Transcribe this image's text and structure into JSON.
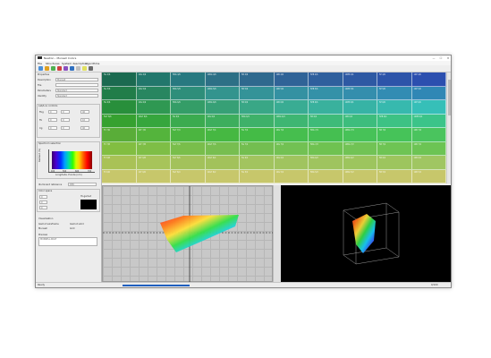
{
  "window": {
    "title": "Newton - Munsell Colors",
    "controls": [
      "—",
      "☐",
      "✕"
    ]
  },
  "menu": [
    "File",
    "Structures",
    "System description",
    "Algorithms"
  ],
  "toolbar": {
    "icon_colors": [
      "#4a90d9",
      "#e0a020",
      "#50b050",
      "#d04040",
      "#8a50c0",
      "#3070c0",
      "#c0c0c0",
      "#e0e060",
      "#6a6a6a"
    ]
  },
  "left_panel": {
    "header": "Properties",
    "rows": [
      {
        "label": "Description",
        "value": "Munsell"
      },
      {
        "label": "File",
        "value": ""
      },
      {
        "label": "Parameters",
        "value": "Standard"
      },
      {
        "label": "Identity",
        "value": "Standard"
      }
    ],
    "section_lab": "Lab/Luv controls",
    "lab_rows": [
      {
        "label": "Fbg",
        "a": "0",
        "b": "0",
        "c": "40"
      },
      {
        "label": "Fb",
        "a": "0",
        "b": "0",
        "c": "10"
      },
      {
        "label": "Cg",
        "a": "0",
        "b": "0",
        "c": "40"
      }
    ],
    "section_spectrum": "Spectrum selection",
    "spectrum_ylabel": "Radiant (%)",
    "spectrum_xlabel": "Longitude d'onde (nm)",
    "spectrum_ticks": [
      "400",
      "500",
      "600",
      "700"
    ],
    "section_illuminant": "Illuminant reference",
    "illuminant_value": "D65",
    "section_color": "Color space",
    "color_fields": [
      "0",
      "0",
      "0"
    ],
    "color_label": "Hi-gamut",
    "section_visual": "Visualisation",
    "visual_options": [
      "Gamut wireframe",
      "Gamut solid",
      "Munsell",
      "Grid"
    ],
    "notes_label": "Preview",
    "notes_value": "MUNSELL.RCAT"
  },
  "grid": {
    "hue_stops": [
      {
        "h": 160,
        "s": 60,
        "l": 26
      },
      {
        "h": 172,
        "s": 56,
        "l": 30
      },
      {
        "h": 185,
        "s": 52,
        "l": 33
      },
      {
        "h": 195,
        "s": 50,
        "l": 35
      },
      {
        "h": 203,
        "s": 50,
        "l": 37
      },
      {
        "h": 210,
        "s": 52,
        "l": 39
      },
      {
        "h": 214,
        "s": 54,
        "l": 40
      },
      {
        "h": 218,
        "s": 56,
        "l": 41
      },
      {
        "h": 221,
        "s": 58,
        "l": 42
      },
      {
        "h": 224,
        "s": 60,
        "l": 43
      }
    ],
    "rows": 8,
    "bottom_hue": 60,
    "cell_labels": [
      [
        "5G 4/6",
        "10G 4/6",
        "5BG 4/6",
        "10BG 4/6",
        "5B 4/6",
        "10B 4/6",
        "5PB 4/6",
        "10PB 4/6",
        "5P 4/6",
        "10P 4/6"
      ],
      [
        "5G 5/6",
        "10G 5/6",
        "5BG 5/6",
        "10BG 5/6",
        "5B 5/6",
        "10B 5/6",
        "5PB 5/6",
        "10PB 5/6",
        "5P 5/6",
        "10P 5/6"
      ],
      [
        "5G 6/6",
        "10G 6/6",
        "5BG 6/6",
        "10BG 6/6",
        "5B 6/6",
        "10B 6/6",
        "5PB 6/6",
        "10PB 6/6",
        "5P 6/6",
        "10P 6/6"
      ],
      [
        "5GY 6/6",
        "10GY 6/6",
        "5G 6/4",
        "10G 6/4",
        "5BG 6/4",
        "10BG 6/4",
        "5B 6/4",
        "10B 6/4",
        "5PB 6/4",
        "10PB 6/4"
      ],
      [
        "5Y 7/6",
        "10Y 7/6",
        "5GY 7/4",
        "10GY 7/4",
        "5G 7/4",
        "10G 7/4",
        "5BG 7/4",
        "10BG 7/4",
        "5B 7/4",
        "10B 7/4"
      ],
      [
        "5Y 7/8",
        "10Y 7/8",
        "5GY 7/6",
        "10GY 7/6",
        "5G 7/2",
        "10G 7/2",
        "5BG 7/2",
        "10BG 7/2",
        "5B 7/2",
        "10B 7/2"
      ],
      [
        "5Y 6/8",
        "10Y 6/8",
        "5GY 6/6",
        "10GY 6/4",
        "5G 6/2",
        "10G 6/2",
        "5BG 6/2",
        "10BG 6/2",
        "5B 6/2",
        "10B 6/2"
      ],
      [
        "5Y 6/6",
        "10Y 6/6",
        "5GY 6/4",
        "10GY 6/2",
        "5G 5/2",
        "10G 5/2",
        "5BG 5/2",
        "10BG 5/2",
        "5B 5/2",
        "10B 5/2"
      ]
    ]
  },
  "plot2d": {
    "gamut_colors": [
      "#ff2a2a",
      "#ff7a1a",
      "#ffe03a",
      "#33e04a",
      "#1ad0ff",
      "#3a4bff",
      "#b03aff"
    ]
  },
  "status": {
    "left": "Ready",
    "right": "0/100"
  }
}
